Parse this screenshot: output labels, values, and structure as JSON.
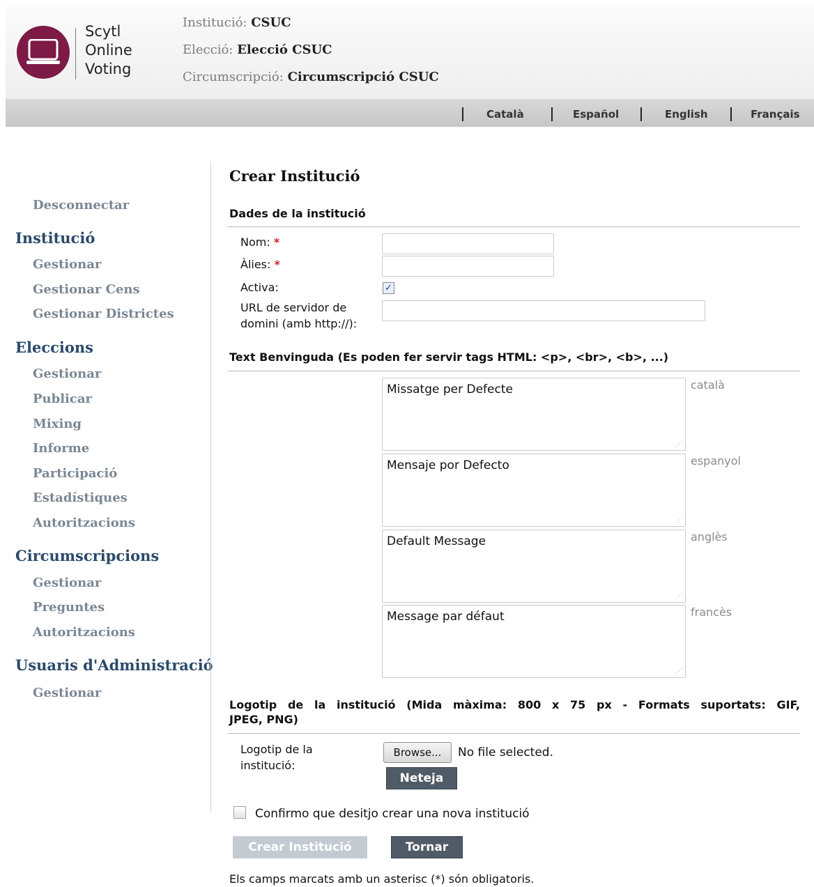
{
  "header": {
    "brand_lines": [
      "Scytl",
      "Online",
      "Voting"
    ],
    "institution_label": "Institució:",
    "institution_value": "CSUC",
    "election_label": "Elecció:",
    "election_value": "Elecció CSUC",
    "district_label": "Circumscripció:",
    "district_value": "Circumscripció CSUC"
  },
  "languages": [
    "Català",
    "Español",
    "English",
    "Français"
  ],
  "sidebar": {
    "logout": "Desconnectar",
    "institution_heading": "Institució",
    "institution_items": [
      "Gestionar",
      "Gestionar Cens",
      "Gestionar Districtes"
    ],
    "elections_heading": "Eleccions",
    "elections_items": [
      "Gestionar",
      "Publicar",
      "Mixing",
      "Informe",
      "Participació",
      "Estadístiques",
      "Autoritzacions"
    ],
    "districts_heading": "Circumscripcions",
    "districts_items": [
      "Gestionar",
      "Preguntes",
      "Autoritzacions"
    ],
    "admins_heading": "Usuaris d'Administració",
    "admins_items": [
      "Gestionar"
    ]
  },
  "form": {
    "title": "Crear Institució",
    "section_data": "Dades de la institució",
    "name_label": "Nom:",
    "alias_label": "Àlies:",
    "required_mark": "*",
    "active_label": "Activa:",
    "active_checked": true,
    "url_label_1": "URL de servidor de",
    "url_label_2": "domini (amb http://):",
    "name_value": "",
    "alias_value": "",
    "url_value": "",
    "section_welcome": "Text Benvinguda (Es poden fer servir tags HTML: <p>, <br>, <b>, ...)",
    "welcome_messages": [
      {
        "text": "Missatge per Defecte",
        "lang": "català"
      },
      {
        "text": "Mensaje por Defecto",
        "lang": "espanyol"
      },
      {
        "text": "Default Message",
        "lang": "anglès"
      },
      {
        "text": "Message par défaut",
        "lang": "francès"
      }
    ],
    "section_logo_1": "Logotip de la institució (Mida màxima: 800 x 75 px - Formats suportats: GIF,",
    "section_logo_2": "JPEG, PNG)",
    "logo_label_1": "Logotip de la",
    "logo_label_2": "institució:",
    "browse_label": "Browse...",
    "no_file_text": "No file selected.",
    "clear_label": "Neteja",
    "confirm_label": "Confirmo que desitjo crear una nova institució",
    "confirm_checked": false,
    "create_label": "Crear Institució",
    "back_label": "Tornar",
    "footnote": "Els camps marcats amb un asterisc (*) són obligatoris."
  },
  "colors": {
    "brand": "#7d1a45",
    "sidebar_heading": "#2b4a6a",
    "sidebar_link": "#7a8794",
    "button_dark": "#4f5b66",
    "button_disabled": "#c3cad2",
    "required": "#d21f2a"
  },
  "icons": [
    "laptop-icon",
    "resize-grip-icon",
    "checkmark-icon"
  ]
}
